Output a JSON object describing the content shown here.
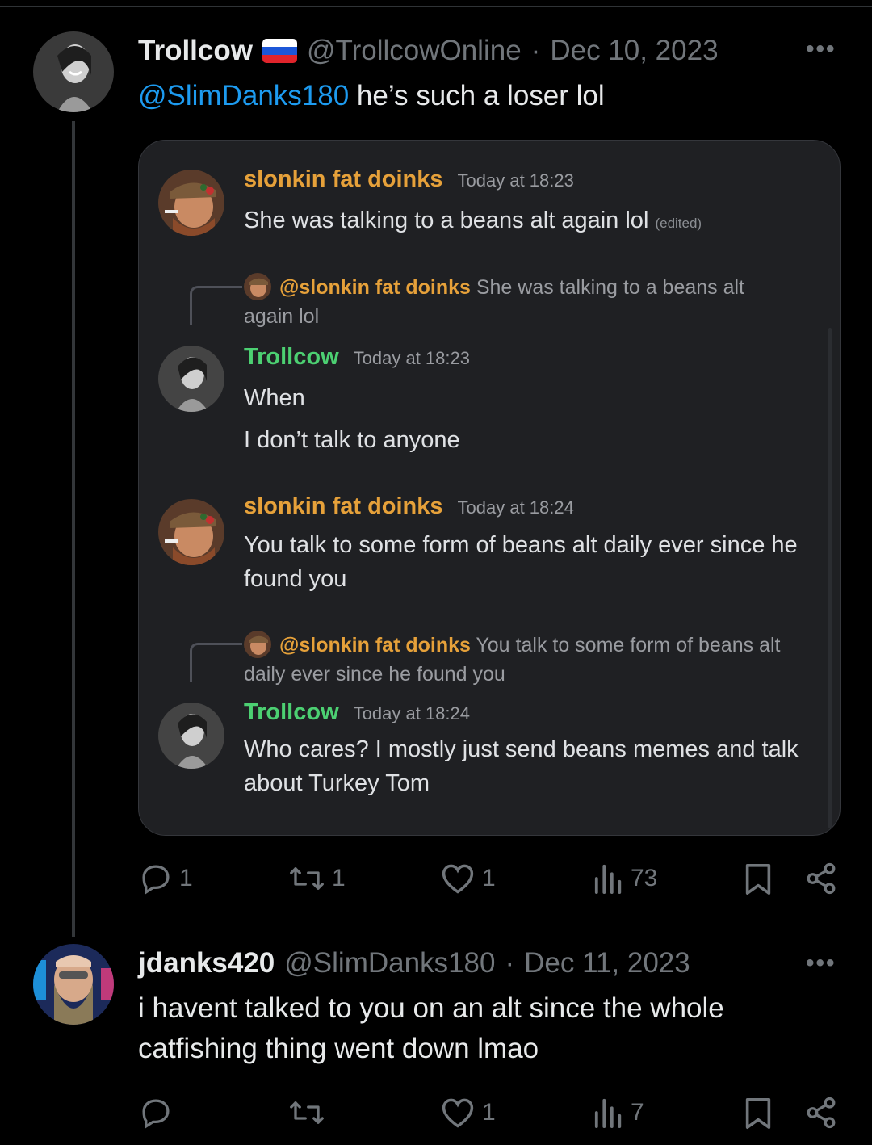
{
  "tweet1": {
    "display_name": "Trollcow",
    "flag": "russia-flag",
    "handle": "@TrollcowOnline",
    "separator": "·",
    "date": "Dec 10, 2023",
    "more": "•••",
    "mention": "@SlimDanks180",
    "text": " he’s such a loser lol",
    "actions": {
      "replies": "1",
      "reposts": "1",
      "likes": "1",
      "views": "73"
    }
  },
  "embed": {
    "messages": [
      {
        "author": "slonkin fat doinks",
        "time": "Today at 18:23",
        "lines": [
          "She was talking to a beans alt again lol"
        ],
        "edited": "(edited)"
      },
      {
        "reply_to_mention": "@slonkin fat doinks",
        "reply_to_text": " She was talking to a beans alt again lol"
      },
      {
        "author": "Trollcow",
        "time": "Today at 18:23",
        "lines": [
          "When",
          "I don’t talk to anyone"
        ]
      },
      {
        "author": "slonkin fat doinks",
        "time": "Today at 18:24",
        "lines": [
          "You talk to some form of beans alt daily ever since he found you"
        ]
      },
      {
        "reply_to_mention": "@slonkin fat doinks",
        "reply_to_text": " You talk to some form of beans alt daily ever since he found you"
      },
      {
        "author": "Trollcow",
        "time": "Today at 18:24",
        "lines": [
          "Who cares? I mostly just send beans memes and talk about Turkey Tom"
        ]
      }
    ]
  },
  "tweet2": {
    "display_name": "jdanks420",
    "handle": "@SlimDanks180",
    "separator": "·",
    "date": "Dec 11, 2023",
    "more": "•••",
    "text": "i havent talked to you on an alt since the whole catfishing thing went down lmao",
    "actions": {
      "replies": "",
      "reposts": "",
      "likes": "1",
      "views": "7"
    }
  },
  "colors": {
    "background": "#000000",
    "link": "#1d9bf0",
    "muted": "#71767b",
    "discord_orange": "#e6a13a",
    "discord_green": "#4cd072",
    "card_bg": "#1f2023"
  }
}
